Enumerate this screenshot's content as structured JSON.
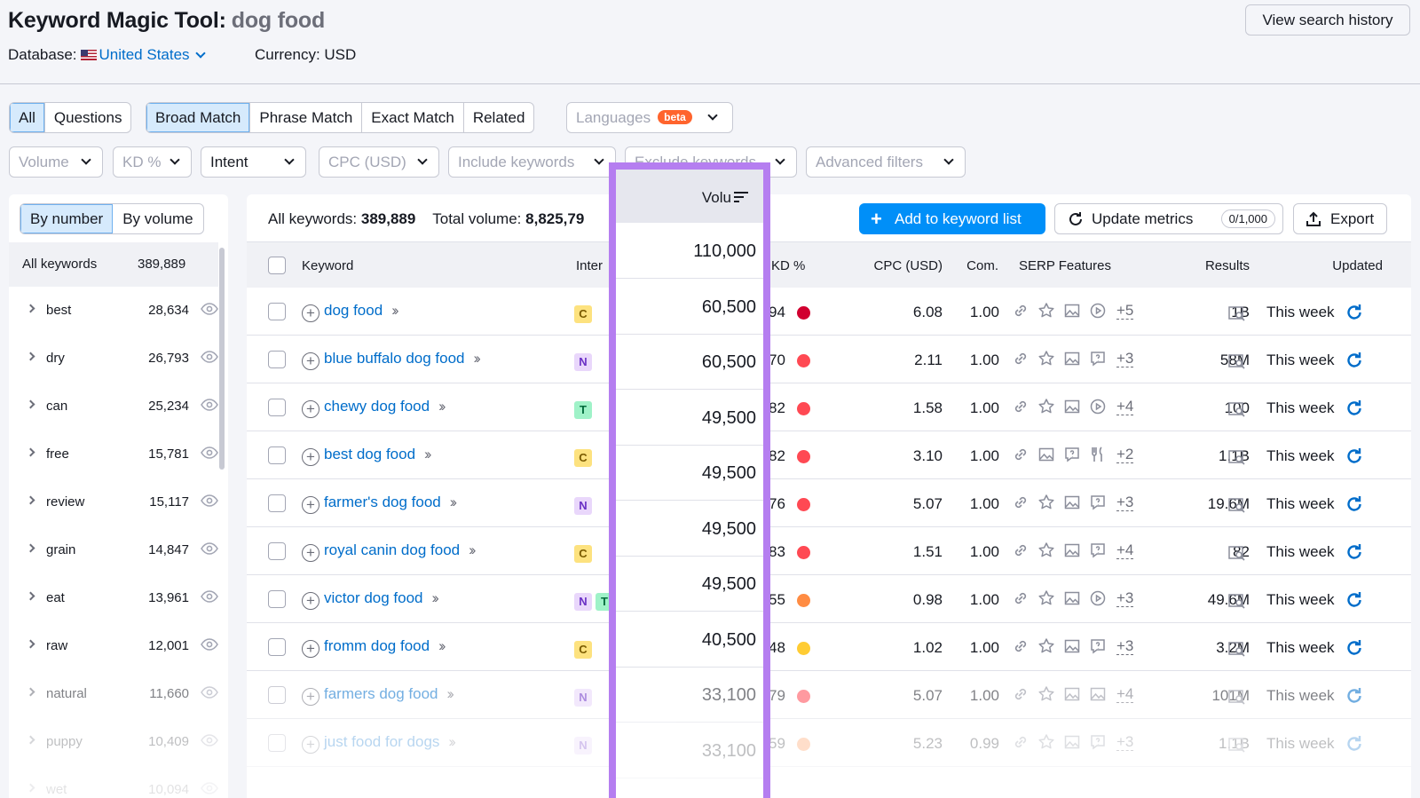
{
  "header": {
    "title": "Keyword Magic Tool:",
    "query": "dog food",
    "database_label": "Database:",
    "database_value": "United States",
    "currency": "Currency: USD",
    "history_button": "View search history"
  },
  "match_tabs": {
    "group1": [
      "All",
      "Questions"
    ],
    "group2": [
      "Broad Match",
      "Phrase Match",
      "Exact Match",
      "Related"
    ],
    "languages": "Languages",
    "beta": "beta"
  },
  "filters": [
    "Volume",
    "KD %",
    "Intent",
    "CPC (USD)",
    "Include keywords",
    "Exclude keywords",
    "Advanced filters"
  ],
  "sidebar": {
    "toggle": [
      "By number",
      "By volume"
    ],
    "all_label": "All keywords",
    "all_count": "389,889",
    "groups": [
      {
        "name": "best",
        "count": "28,634"
      },
      {
        "name": "dry",
        "count": "26,793"
      },
      {
        "name": "can",
        "count": "25,234"
      },
      {
        "name": "free",
        "count": "15,781"
      },
      {
        "name": "review",
        "count": "15,117"
      },
      {
        "name": "grain",
        "count": "14,847"
      },
      {
        "name": "eat",
        "count": "13,961"
      },
      {
        "name": "raw",
        "count": "12,001"
      },
      {
        "name": "natural",
        "count": "11,660"
      },
      {
        "name": "puppy",
        "count": "10,409"
      },
      {
        "name": "wet",
        "count": "10,094"
      }
    ]
  },
  "summary": {
    "all_label": "All keywords:",
    "all_value": "389,889",
    "vol_label": "Total volume:",
    "vol_value": "8,825,79"
  },
  "actions": {
    "add": "Add to keyword list",
    "update": "Update metrics",
    "update_count": "0/1,000",
    "export": "Export"
  },
  "columns": {
    "keyword": "Keyword",
    "intent": "Inter",
    "volume": "Volu",
    "kd": "KD %",
    "cpc": "CPC (USD)",
    "com": "Com.",
    "serp": "SERP Features",
    "results": "Results",
    "updated": "Updated"
  },
  "rows": [
    {
      "keyword": "dog food",
      "intent": [
        "C"
      ],
      "volume": "110,000",
      "kd": "94",
      "kd_color": "#d1002f",
      "cpc": "6.08",
      "com": "1.00",
      "serp_more": "+5",
      "results": "1B",
      "updated": "This week"
    },
    {
      "keyword": "blue buffalo dog food",
      "intent": [
        "N"
      ],
      "volume": "60,500",
      "kd": "70",
      "kd_color": "#ff4953",
      "cpc": "2.11",
      "com": "1.00",
      "serp_more": "+3",
      "results": "58M",
      "updated": "This week"
    },
    {
      "keyword": "chewy dog food",
      "intent": [
        "T"
      ],
      "volume": "60,500",
      "kd": "82",
      "kd_color": "#ff4953",
      "cpc": "1.58",
      "com": "1.00",
      "serp_more": "+4",
      "results": "100",
      "updated": "This week"
    },
    {
      "keyword": "best dog food",
      "intent": [
        "C"
      ],
      "volume": "49,500",
      "kd": "82",
      "kd_color": "#ff4953",
      "cpc": "3.10",
      "com": "1.00",
      "serp_more": "+2",
      "results": "1.1B",
      "updated": "This week"
    },
    {
      "keyword": "farmer's dog food",
      "intent": [
        "N"
      ],
      "volume": "49,500",
      "kd": "76",
      "kd_color": "#ff4953",
      "cpc": "5.07",
      "com": "1.00",
      "serp_more": "+3",
      "results": "19.6M",
      "updated": "This week"
    },
    {
      "keyword": "royal canin dog food",
      "intent": [
        "C"
      ],
      "volume": "49,500",
      "kd": "83",
      "kd_color": "#ff4953",
      "cpc": "1.51",
      "com": "1.00",
      "serp_more": "+4",
      "results": "82",
      "updated": "This week"
    },
    {
      "keyword": "victor dog food",
      "intent": [
        "N",
        "T"
      ],
      "volume": "49,500",
      "kd": "55",
      "kd_color": "#ff8c43",
      "cpc": "0.98",
      "com": "1.00",
      "serp_more": "+3",
      "results": "49.6M",
      "updated": "This week"
    },
    {
      "keyword": "fromm dog food",
      "intent": [
        "C"
      ],
      "volume": "40,500",
      "kd": "48",
      "kd_color": "#ffcc33",
      "cpc": "1.02",
      "com": "1.00",
      "serp_more": "+3",
      "results": "3.2M",
      "updated": "This week"
    },
    {
      "keyword": "farmers dog food",
      "intent": [
        "N"
      ],
      "volume": "33,100",
      "kd": "79",
      "kd_color": "#ff4953",
      "cpc": "5.07",
      "com": "1.00",
      "serp_more": "+4",
      "results": "101M",
      "updated": "This week"
    },
    {
      "keyword": "just food for dogs",
      "intent": [
        "N"
      ],
      "volume": "33,100",
      "kd": "59",
      "kd_color": "#ff8c43",
      "cpc": "5.23",
      "com": "0.99",
      "serp_more": "+3",
      "results": "1.1B",
      "updated": "This week"
    }
  ],
  "colors": {
    "accent": "#008ff8",
    "link": "#006dca",
    "highlight": "#b57ef0"
  }
}
